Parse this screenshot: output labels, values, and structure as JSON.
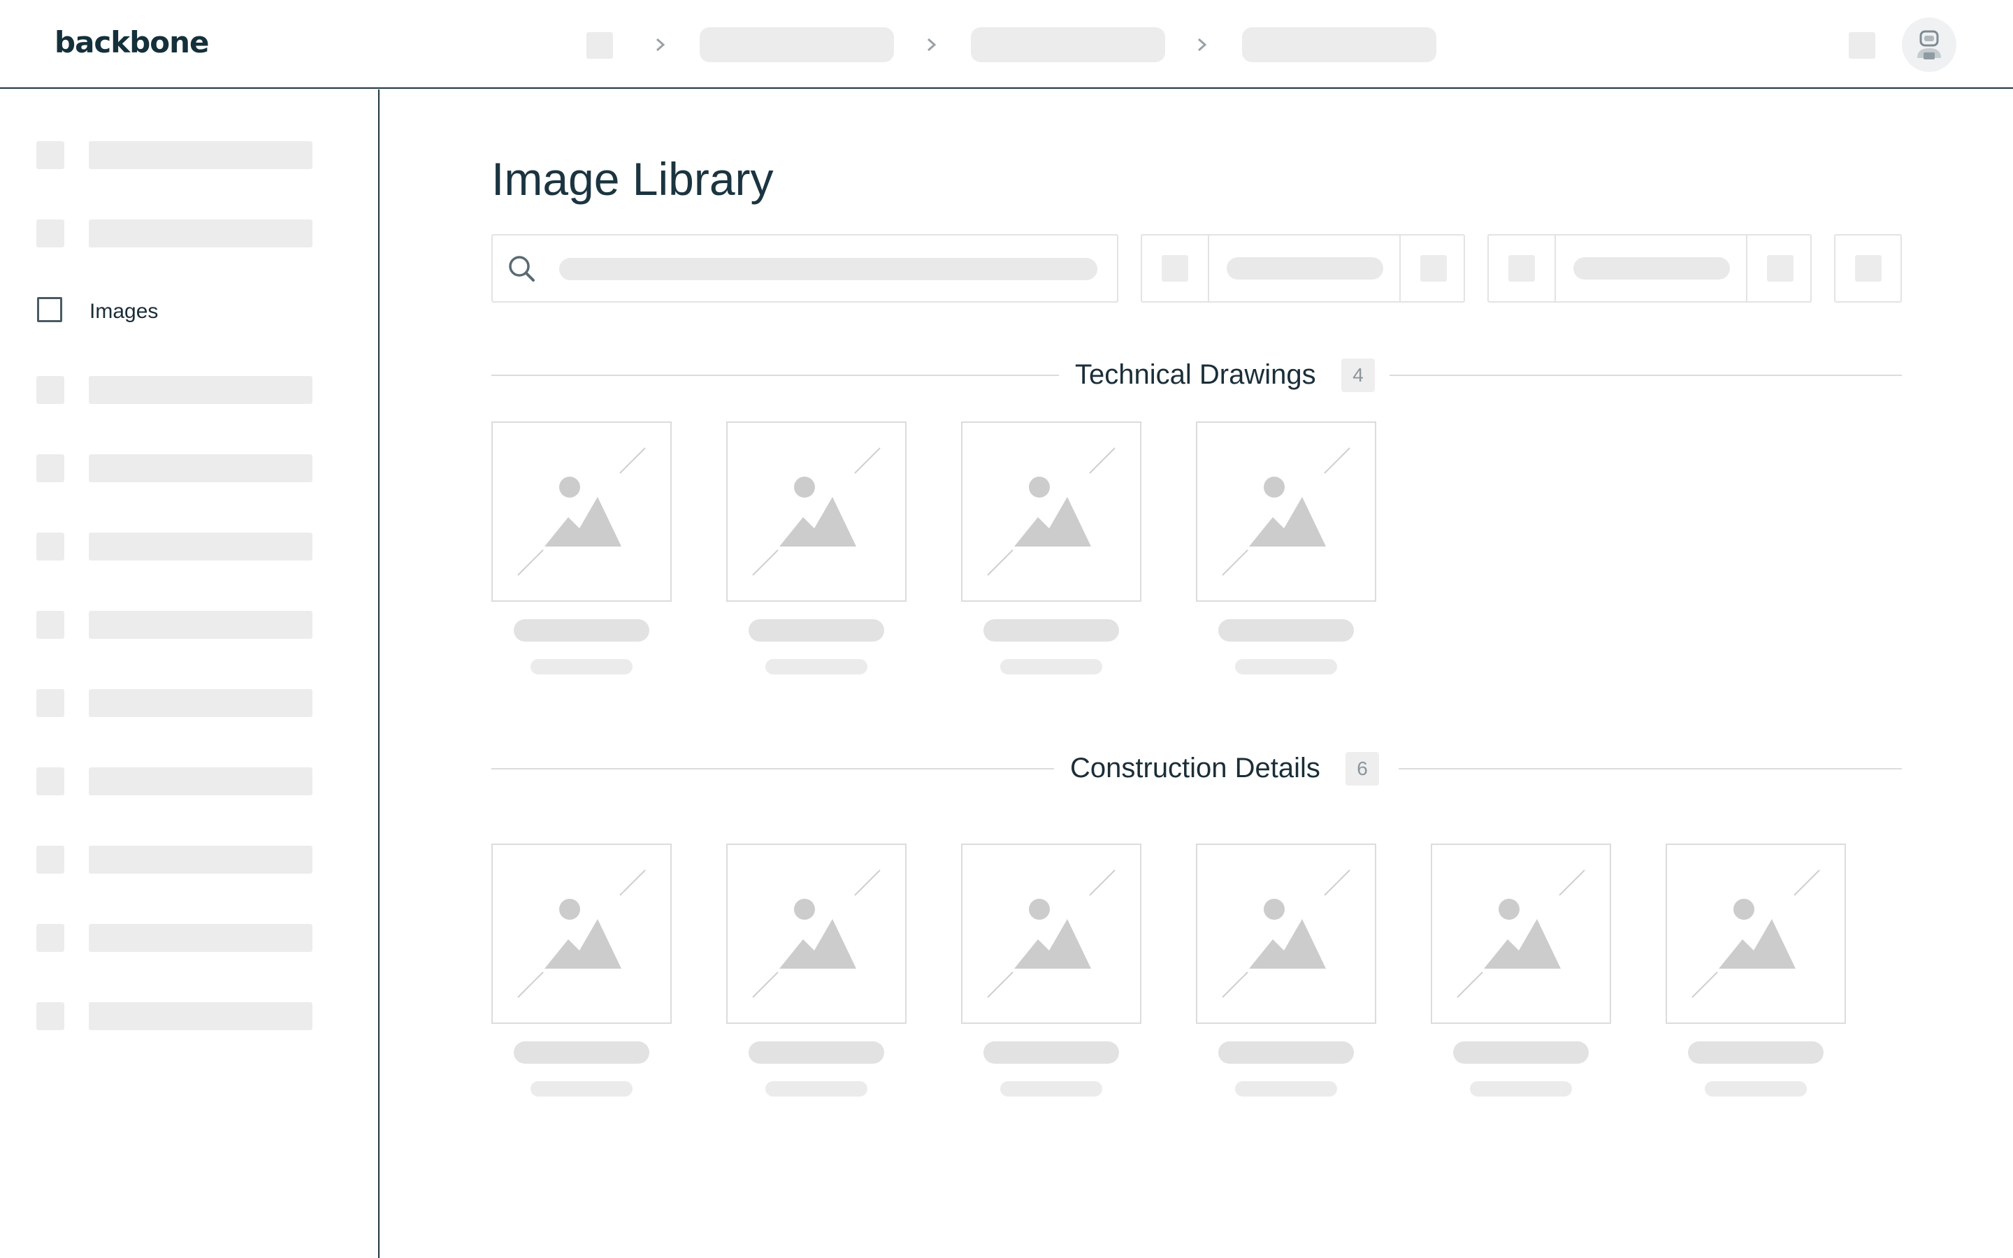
{
  "app": {
    "logo_text": "backbone",
    "colors": {
      "accent": "#1f3540",
      "placeholder": "#ececec",
      "text": "#1b2e38"
    }
  },
  "header": {
    "breadcrumb_icon": "home-icon",
    "separator_icon": "chevron-right-icon",
    "right_icon": "notification-icon",
    "avatar_icon": "robot-avatar-icon"
  },
  "sidebar": {
    "active_item": {
      "label": "Images",
      "icon": "checkbox-icon"
    }
  },
  "main": {
    "title": "Image Library",
    "search": {
      "icon": "search-icon"
    },
    "sections": [
      {
        "title": "Technical Drawings",
        "count": "4"
      },
      {
        "title": "Construction Details",
        "count": "6"
      }
    ],
    "thumbnail_icon": "image-placeholder-icon"
  }
}
